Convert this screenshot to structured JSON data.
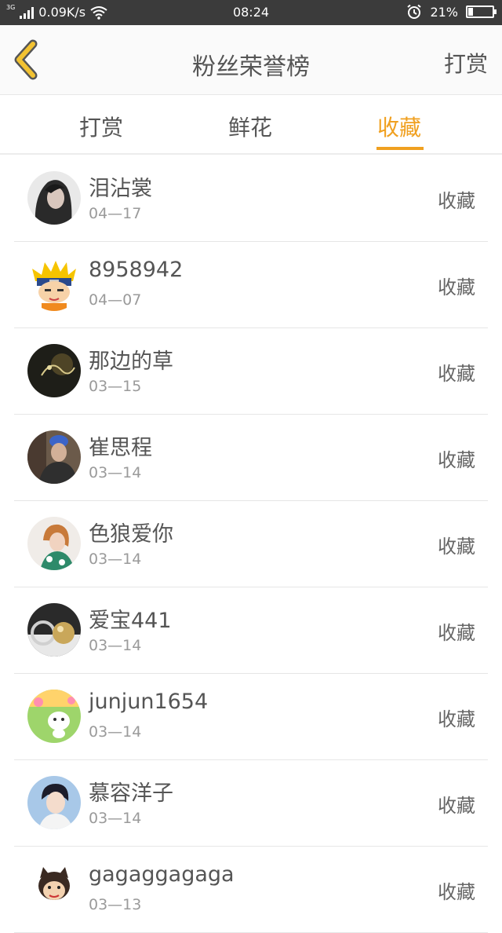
{
  "status_bar": {
    "network_tag": "3G",
    "speed": "0.09K/s",
    "time": "08:24",
    "battery": "21%",
    "battery_level": 0.21,
    "icons": [
      "signal-icon",
      "wifi-icon",
      "alarm-icon",
      "battery-icon"
    ]
  },
  "header": {
    "back_icon": "chevron-left-icon",
    "title": "粉丝荣誉榜",
    "right_link": "打赏"
  },
  "tabs": {
    "items": [
      "打赏",
      "鲜花",
      "收藏"
    ],
    "active_index": 2,
    "accent_color": "#f0a020"
  },
  "list": {
    "items": [
      {
        "name": "泪沾裳",
        "date": "04—17",
        "action": "收藏",
        "avatar": "photo-avatar"
      },
      {
        "name": "8958942",
        "date": "04—07",
        "action": "收藏",
        "avatar": "cartoon-ninja-avatar"
      },
      {
        "name": "那边的草",
        "date": "03—15",
        "action": "收藏",
        "avatar": "dark-photo-avatar"
      },
      {
        "name": "崔思程",
        "date": "03—14",
        "action": "收藏",
        "avatar": "photo-avatar"
      },
      {
        "name": "色狼爱你",
        "date": "03—14",
        "action": "收藏",
        "avatar": "photo-avatar"
      },
      {
        "name": "爱宝441",
        "date": "03—14",
        "action": "收藏",
        "avatar": "pearl-ring-avatar"
      },
      {
        "name": "junjun1654",
        "date": "03—14",
        "action": "收藏",
        "avatar": "cartoon-cat-avatar"
      },
      {
        "name": "慕容洋子",
        "date": "03—14",
        "action": "收藏",
        "avatar": "photo-avatar"
      },
      {
        "name": "gagaggagaga",
        "date": "03—13",
        "action": "收藏",
        "avatar": "cartoon-cat-avatar"
      }
    ]
  }
}
